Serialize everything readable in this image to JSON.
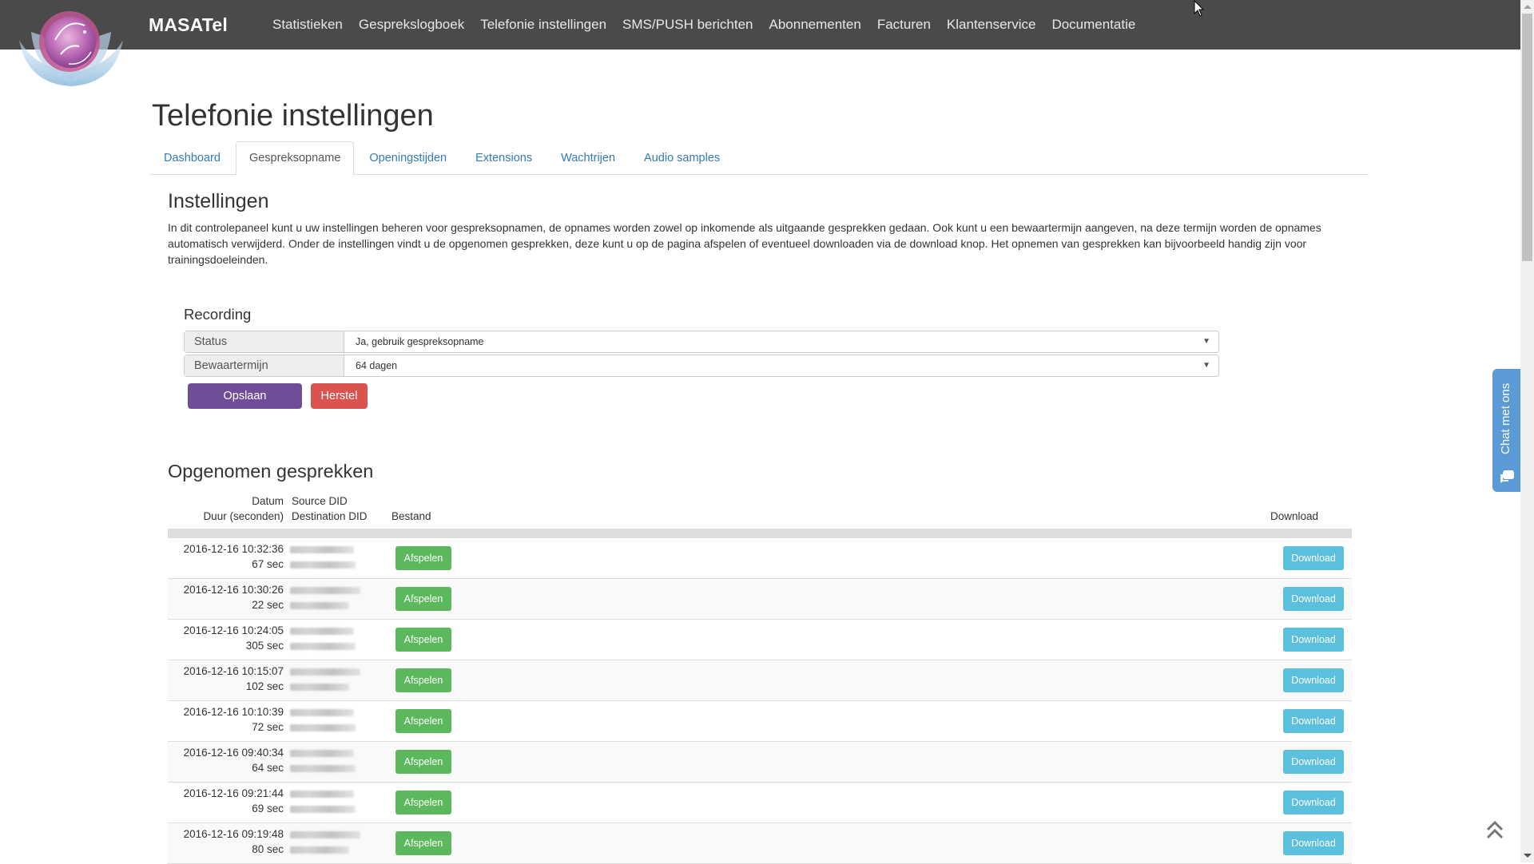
{
  "brand": "MASATel",
  "nav": {
    "items": [
      "Statistieken",
      "Gesprekslogboek",
      "Telefonie instellingen",
      "SMS/PUSH berichten",
      "Abonnementen",
      "Facturen",
      "Klantenservice",
      "Documentatie"
    ]
  },
  "page_title": "Telefonie instellingen",
  "tabs": [
    {
      "label": "Dashboard",
      "active": false
    },
    {
      "label": "Gespreksopname",
      "active": true
    },
    {
      "label": "Openingstijden",
      "active": false
    },
    {
      "label": "Extensions",
      "active": false
    },
    {
      "label": "Wachtrijen",
      "active": false
    },
    {
      "label": "Audio samples",
      "active": false
    }
  ],
  "settings": {
    "title": "Instellingen",
    "intro": "In dit controlepaneel kunt u uw instellingen beheren voor gespreksopnamen, de opnames worden zowel op inkomende als uitgaande gesprekken gedaan. Ook kunt u een bewaartermijn aangeven, na deze termijn worden de opnames automatisch verwijderd. Onder de instellingen vindt u de opgenomen gesprekken, deze kunt u op de pagina afspelen of eventueel downloaden via de download knop. Het opnemen van gesprekken kan bijvoorbeeld handig zijn voor trainingsdoeleinden."
  },
  "recording": {
    "title": "Recording",
    "status_label": "Status",
    "status_value": "Ja, gebruik gespreksopname",
    "retention_label": "Bewaartermijn",
    "retention_value": "64 dagen",
    "save_label": "Opslaan",
    "reset_label": "Herstel"
  },
  "recordings": {
    "title": "Opgenomen gesprekken",
    "headers": {
      "date": "Datum",
      "duration": "Duur (seconden)",
      "source": "Source DID",
      "destination": "Destination DID",
      "file": "Bestand",
      "download": "Download"
    },
    "play_label": "Afspelen",
    "download_label": "Download",
    "rows": [
      {
        "date": "2016-12-16 10:32:36",
        "duration": "67 sec"
      },
      {
        "date": "2016-12-16 10:30:26",
        "duration": "22 sec"
      },
      {
        "date": "2016-12-16 10:24:05",
        "duration": "305 sec"
      },
      {
        "date": "2016-12-16 10:15:07",
        "duration": "102 sec"
      },
      {
        "date": "2016-12-16 10:10:39",
        "duration": "72 sec"
      },
      {
        "date": "2016-12-16 09:40:34",
        "duration": "64 sec"
      },
      {
        "date": "2016-12-16 09:21:44",
        "duration": "69 sec"
      },
      {
        "date": "2016-12-16 09:19:48",
        "duration": "80 sec"
      }
    ]
  },
  "chat": {
    "label": "Chat met ons",
    "icon": "chat-bubbles-icon"
  },
  "colors": {
    "navbar": "#4a4a4a",
    "save": "#6f4e99",
    "reset": "#d9534f",
    "play": "#5cb85c",
    "download": "#5bc0de",
    "chat": "#5b9bd5",
    "link": "#337ab7"
  }
}
